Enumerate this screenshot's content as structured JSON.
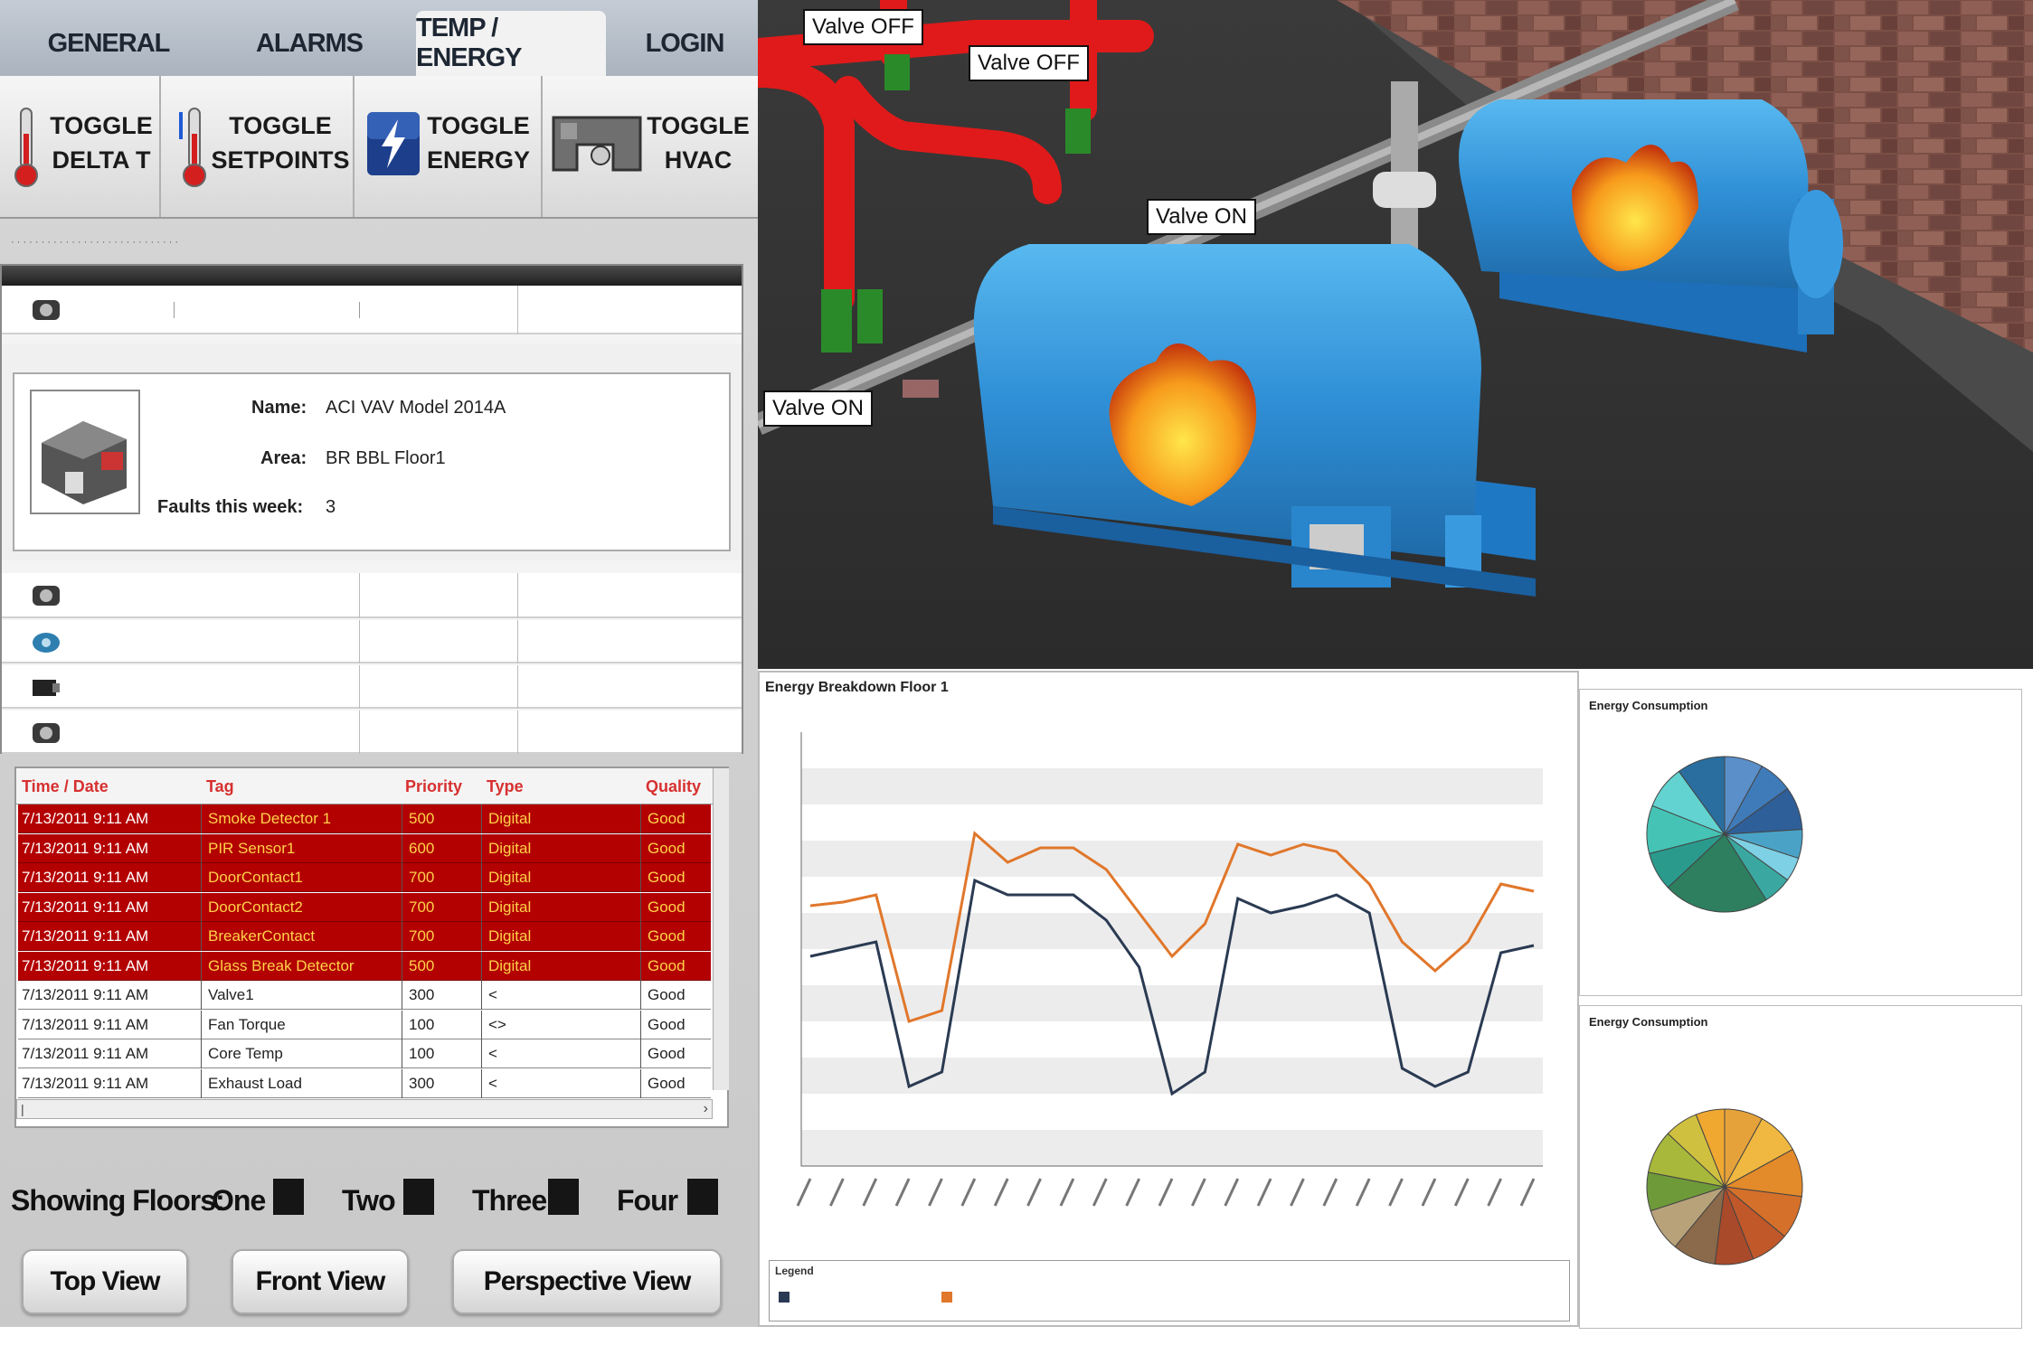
{
  "tabs": [
    "GENERAL",
    "ALARMS",
    "TEMP / ENERGY",
    "LOGIN"
  ],
  "toggles": [
    {
      "label": "TOGGLE\nDELTA T",
      "icon": "thermometer-icon"
    },
    {
      "label": "TOGGLE\nSETPOINTS",
      "icon": "thermometer-setpoint-icon"
    },
    {
      "label": "TOGGLE\nENERGY",
      "icon": "lightning-icon"
    },
    {
      "label": "TOGGLE\nHVAC",
      "icon": "hvac-duct-icon"
    }
  ],
  "device": {
    "name_label": "Name:",
    "name_value": "ACI VAV Model 2014A",
    "area_label": "Area:",
    "area_value": "BR BBL Floor1",
    "faults_label": "Faults this week:",
    "faults_value": "3"
  },
  "alarm_table": {
    "headers": [
      "Time / Date",
      "Tag",
      "Priority",
      "Type",
      "Quality"
    ],
    "rows": [
      {
        "time": "7/13/2011 9:11 AM",
        "tag": "Smoke Detector 1",
        "priority": "500",
        "type": "Digital",
        "quality": "Good",
        "active": true
      },
      {
        "time": "7/13/2011 9:11 AM",
        "tag": "PIR Sensor1",
        "priority": "600",
        "type": "Digital",
        "quality": "Good",
        "active": true
      },
      {
        "time": "7/13/2011 9:11 AM",
        "tag": "DoorContact1",
        "priority": "700",
        "type": "Digital",
        "quality": "Good",
        "active": true
      },
      {
        "time": "7/13/2011 9:11 AM",
        "tag": "DoorContact2",
        "priority": "700",
        "type": "Digital",
        "quality": "Good",
        "active": true
      },
      {
        "time": "7/13/2011 9:11 AM",
        "tag": "BreakerContact",
        "priority": "700",
        "type": "Digital",
        "quality": "Good",
        "active": true
      },
      {
        "time": "7/13/2011 9:11 AM",
        "tag": "Glass Break Detector",
        "priority": "500",
        "type": "Digital",
        "quality": "Good",
        "active": true
      },
      {
        "time": "7/13/2011 9:11 AM",
        "tag": "Valve1",
        "priority": "300",
        "type": "<",
        "quality": "Good",
        "active": false
      },
      {
        "time": "7/13/2011 9:11 AM",
        "tag": "Fan Torque",
        "priority": "100",
        "type": "<>",
        "quality": "Good",
        "active": false
      },
      {
        "time": "7/13/2011 9:11 AM",
        "tag": "Core Temp",
        "priority": "100",
        "type": "<",
        "quality": "Good",
        "active": false
      },
      {
        "time": "7/13/2011 9:11 AM",
        "tag": "Exhaust Load",
        "priority": "300",
        "type": "<",
        "quality": "Good",
        "active": false
      }
    ]
  },
  "floors": {
    "label": "Showing Floors:",
    "options": [
      "One",
      "Two",
      "Three",
      "Four"
    ]
  },
  "view_buttons": [
    "Top View",
    "Front View",
    "Perspective View"
  ],
  "valve_labels": [
    "Valve OFF",
    "Valve OFF",
    "Valve ON",
    "Valve ON"
  ],
  "chart_data": [
    {
      "type": "line",
      "title": "Energy Breakdown Floor 1",
      "series": [
        {
          "name": "",
          "color": "#e0772b",
          "values": [
            7.2,
            7.3,
            7.5,
            4.0,
            4.3,
            9.2,
            8.4,
            8.8,
            8.8,
            8.2,
            7.0,
            5.8,
            6.7,
            8.9,
            8.6,
            8.9,
            8.7,
            7.8,
            6.2,
            5.4,
            6.2,
            7.8,
            7.6
          ]
        },
        {
          "name": "",
          "color": "#2a3a52",
          "values": [
            5.8,
            6.0,
            6.2,
            2.2,
            2.6,
            7.9,
            7.5,
            7.5,
            7.5,
            6.8,
            5.5,
            2.0,
            2.6,
            7.4,
            7.0,
            7.2,
            7.5,
            7.0,
            2.7,
            2.2,
            2.6,
            5.9,
            6.1
          ]
        }
      ],
      "ylim": [
        0,
        12
      ]
    },
    {
      "type": "pie",
      "title": "Energy Consumption",
      "colors": [
        "#5a8fc9",
        "#3f7bb8",
        "#2f5f99",
        "#4aa3c6",
        "#7ed0e4",
        "#3aa8a0",
        "#2e7e60",
        "#2a9a8c",
        "#45c4b5",
        "#62d3d0",
        "#2a6ea0"
      ],
      "values": [
        8,
        7,
        9,
        6,
        5,
        6,
        22,
        8,
        10,
        9,
        10
      ]
    },
    {
      "type": "pie",
      "title": "Energy Consumption",
      "colors": [
        "#e6a23a",
        "#f0b840",
        "#e38a2a",
        "#d4702a",
        "#c0582a",
        "#a94a2a",
        "#8a6a4a",
        "#b8a27a",
        "#6f9a3a",
        "#a8b83a",
        "#d0c040",
        "#f0a830"
      ],
      "values": [
        8,
        9,
        10,
        9,
        8,
        8,
        9,
        9,
        8,
        9,
        7,
        6
      ]
    }
  ]
}
